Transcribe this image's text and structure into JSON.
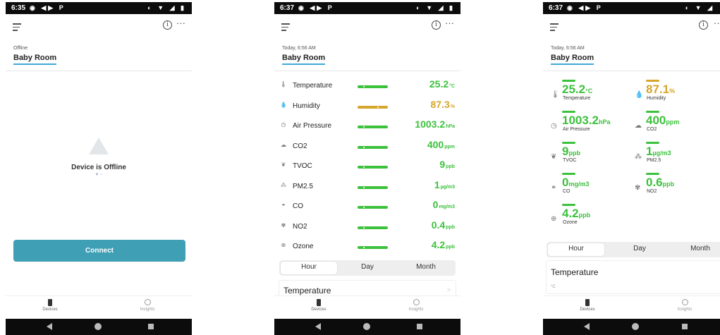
{
  "phone1": {
    "status_time": "6:35",
    "status_icons": "◉ ◀▶ P",
    "status_right": "◐ ▼ ◢ ▮",
    "state_label": "Offline",
    "room": "Baby Room",
    "offline_message": "Device is Offline",
    "offline_sub": "▼ ~",
    "connect_label": "Connect"
  },
  "phone2": {
    "status_time": "6:37",
    "status_icons": "◉ ◀▶ P",
    "status_right": "◐ ▼ ◢ ▮",
    "timestamp": "Today, 6:56 AM",
    "room": "Baby Room",
    "metrics": [
      {
        "icon": "thermometer-icon",
        "glyph": "🌡",
        "label": "Temperature",
        "value": "25.2",
        "unit": "°C",
        "status": "green"
      },
      {
        "icon": "droplet-icon",
        "glyph": "💧",
        "label": "Humidity",
        "value": "87.3",
        "unit": "%",
        "status": "amber"
      },
      {
        "icon": "gauge-icon",
        "glyph": "◷",
        "label": "Air Pressure",
        "value": "1003.2",
        "unit": "hPa",
        "status": "green"
      },
      {
        "icon": "cloud-icon",
        "glyph": "☁",
        "label": "CO2",
        "value": "400",
        "unit": "ppm",
        "status": "green"
      },
      {
        "icon": "leaf-icon",
        "glyph": "❦",
        "label": "TVOC",
        "value": "9",
        "unit": "ppb",
        "status": "green"
      },
      {
        "icon": "particles-icon",
        "glyph": "⁂",
        "label": "PM2.5",
        "value": "1",
        "unit": "µg/m3",
        "status": "green"
      },
      {
        "icon": "molecule-icon",
        "glyph": "⚭",
        "label": "CO",
        "value": "0",
        "unit": "mg/m3",
        "status": "green"
      },
      {
        "icon": "no2-icon",
        "glyph": "✾",
        "label": "NO2",
        "value": "0.4",
        "unit": "ppb",
        "status": "green"
      },
      {
        "icon": "globe-icon",
        "glyph": "⊕",
        "label": "Ozone",
        "value": "4.2",
        "unit": "ppb",
        "status": "green"
      }
    ],
    "range_options": [
      "Hour",
      "Day",
      "Month"
    ],
    "range_selected": "Hour",
    "chart_card_title": "Temperature"
  },
  "phone3": {
    "status_time": "6:37",
    "status_icons": "◉ ◀▶ P",
    "status_right": "◐ ▼ ◢",
    "timestamp": "Today, 6:56 AM",
    "room": "Baby Room",
    "tiles": [
      {
        "icon": "thermometer-icon",
        "glyph": "🌡",
        "label": "Temperature",
        "value": "25.2",
        "unit": "°C",
        "status": "green"
      },
      {
        "icon": "droplet-icon",
        "glyph": "💧",
        "label": "Humidity",
        "value": "87.1",
        "unit": "%",
        "status": "amber"
      },
      {
        "icon": "gauge-icon",
        "glyph": "◷",
        "label": "Air Pressure",
        "value": "1003.2",
        "unit": "hPa",
        "status": "green"
      },
      {
        "icon": "cloud-icon",
        "glyph": "☁",
        "label": "CO2",
        "value": "400",
        "unit": "ppm",
        "status": "green"
      },
      {
        "icon": "leaf-icon",
        "glyph": "❦",
        "label": "TVOC",
        "value": "9",
        "unit": "ppb",
        "status": "green"
      },
      {
        "icon": "particles-icon",
        "glyph": "⁂",
        "label": "PM2.5",
        "value": "1",
        "unit": "µg/m3",
        "status": "green"
      },
      {
        "icon": "molecule-icon",
        "glyph": "⚭",
        "label": "CO",
        "value": "0",
        "unit": "mg/m3",
        "status": "green"
      },
      {
        "icon": "no2-icon",
        "glyph": "✾",
        "label": "NO2",
        "value": "0.6",
        "unit": "ppb",
        "status": "green"
      },
      {
        "icon": "globe-icon",
        "glyph": "⊕",
        "label": "Ozone",
        "value": "4.2",
        "unit": "ppb",
        "status": "green"
      }
    ],
    "range_options": [
      "Hour",
      "Day",
      "Month"
    ],
    "range_selected": "Hour",
    "chart_card_title": "Temperature",
    "chart_axis_label": "°C"
  },
  "nav": {
    "devices": "Devices",
    "insights": "Insights"
  },
  "colors": {
    "good": "#3cc13c",
    "warning": "#d5a62b",
    "accent": "#40a9d8",
    "connect": "#3f9fb5"
  }
}
